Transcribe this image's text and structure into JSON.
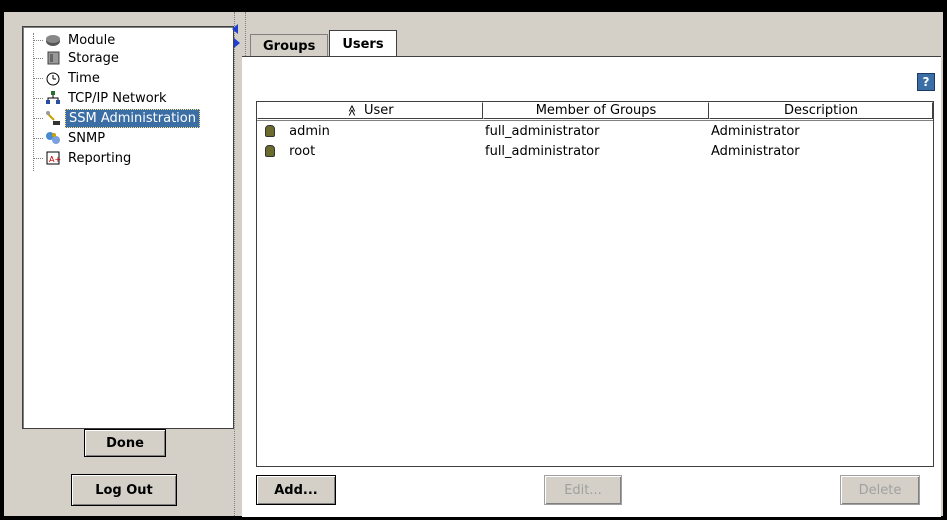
{
  "tree": {
    "items": [
      {
        "label": "Module",
        "icon": "module-icon"
      },
      {
        "label": "Storage",
        "icon": "storage-icon"
      },
      {
        "label": "Time",
        "icon": "clock-icon"
      },
      {
        "label": "TCP/IP Network",
        "icon": "network-icon"
      },
      {
        "label": "SSM Administration",
        "icon": "admin-icon",
        "selected": true
      },
      {
        "label": "SNMP",
        "icon": "snmp-icon"
      },
      {
        "label": "Reporting",
        "icon": "reporting-icon"
      }
    ]
  },
  "left_buttons": {
    "done": "Done",
    "logout": "Log Out"
  },
  "tabs": [
    {
      "label": "Groups",
      "active": false
    },
    {
      "label": "Users",
      "active": true
    }
  ],
  "help": {
    "label": "?"
  },
  "table": {
    "sort_glyph": "≪",
    "columns": [
      "User",
      "Member of Groups",
      "Description"
    ],
    "rows": [
      {
        "user": "admin",
        "groups": "full_administrator",
        "description": "Administrator"
      },
      {
        "user": "root",
        "groups": "full_administrator",
        "description": "Administrator"
      }
    ]
  },
  "actions": {
    "add": "Add...",
    "edit": "Edit...",
    "delete": "Delete"
  },
  "colors": {
    "selection": "#3a6ea5",
    "panel": "#d4d0c8"
  }
}
